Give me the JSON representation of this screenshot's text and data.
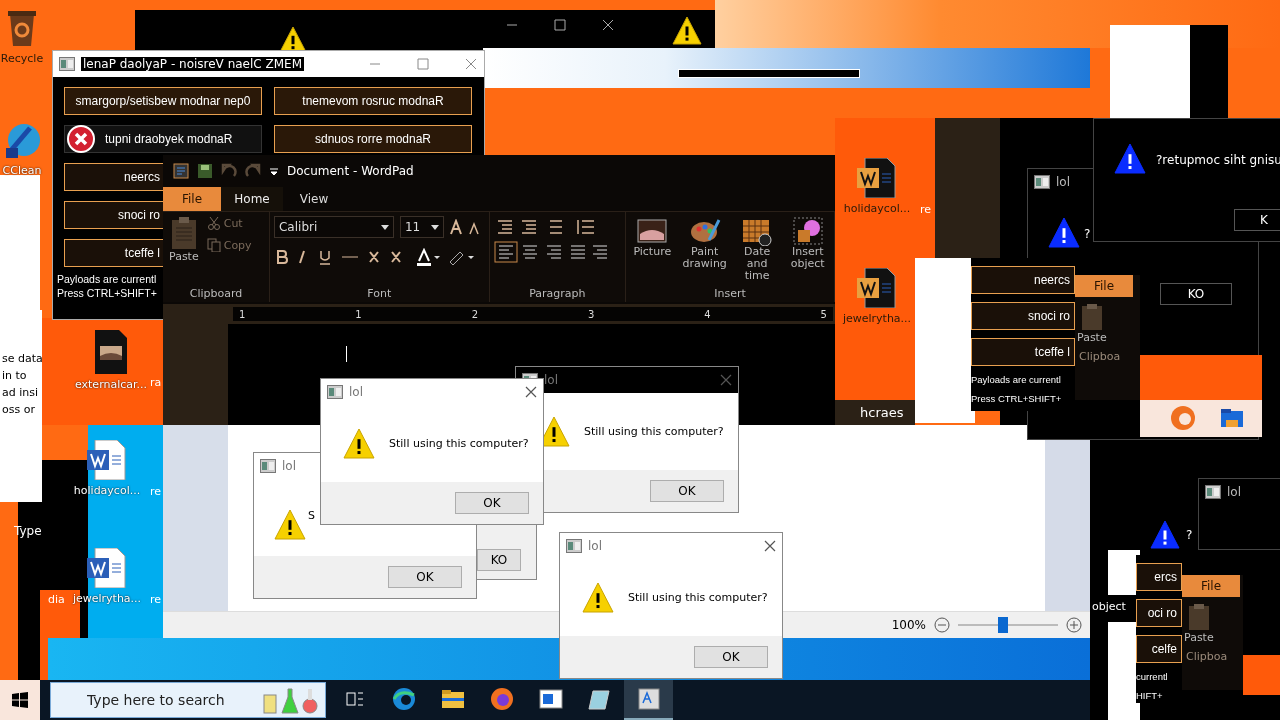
{
  "desktop": {
    "icons": [
      {
        "label": "Recycle",
        "kind": "bin"
      },
      {
        "label": "CClean",
        "kind": "cleaner"
      },
      {
        "label": "externalcar...",
        "kind": "image"
      },
      {
        "label": "ra",
        "kind": "stub"
      },
      {
        "label": "holidaycol...",
        "kind": "word"
      },
      {
        "label": "re",
        "kind": "stub"
      },
      {
        "label": "dia",
        "kind": "stub"
      },
      {
        "label": "jewelrytha...",
        "kind": "word"
      },
      {
        "label": "re",
        "kind": "stub"
      },
      {
        "label": "holidaycol...",
        "kind": "word-dark"
      },
      {
        "label": "re",
        "kind": "stub"
      },
      {
        "label": "jewelrytha...",
        "kind": "word-dark"
      }
    ]
  },
  "left_fragment": {
    "lines": [
      "se data",
      "in to",
      "ad insi",
      "oss or"
    ],
    "type_stub": "Type"
  },
  "memz_panel": {
    "title": "lenaP daolyaP - noisreV naelC ZMEM",
    "buttons": [
      "smargorp/setisbew modnar nep0",
      "tnemevom rosruc modnaR",
      "tupni draobyek modnaR",
      "sdnuos rorre modnaR"
    ],
    "covered_buttons": [
      "neercs",
      "snoci ro",
      "tceffe l"
    ],
    "status": [
      "Payloads are currentl",
      "Press CTRL+SHIFT+"
    ]
  },
  "wordpad": {
    "title": "Document - WordPad",
    "tabs": [
      {
        "label": "File",
        "kind": "file",
        "selected": false
      },
      {
        "label": "Home",
        "kind": "tab",
        "selected": true
      },
      {
        "label": "View",
        "kind": "tab",
        "selected": false
      }
    ],
    "clipboard": {
      "paste": "Paste",
      "cut": "Cut",
      "copy": "Copy",
      "group": "Clipboard"
    },
    "font": {
      "family": "Calibri",
      "size": "11",
      "group": "Font"
    },
    "paragraph": {
      "group": "Paragraph"
    },
    "insert": {
      "items": [
        {
          "label": "Picture",
          "kind": "picture"
        },
        {
          "label": "Paint drawing",
          "kind": "paint"
        },
        {
          "label": "Date and time",
          "kind": "date"
        },
        {
          "label": "Insert object",
          "kind": "object"
        }
      ],
      "group": "Insert"
    },
    "ruler": [
      "1",
      "1",
      "2",
      "3",
      "4",
      "5"
    ]
  },
  "status_bar": {
    "zoom": "100%",
    "level": 0.45
  },
  "dialogs": [
    {
      "title": "lol",
      "message": "Still using this computer?",
      "button": "OK"
    },
    {
      "title": "lol",
      "message": "S",
      "button": "OK"
    },
    {
      "title": "lol",
      "message": "Still using this computer?",
      "button": "OK"
    },
    {
      "title": "lol",
      "message": "Still using this computer?",
      "button": "OK"
    }
  ],
  "ko_fragment": {
    "button": "KO"
  },
  "right_fragments": {
    "search_stub": "hcraes",
    "dark_dialog": {
      "title": "lol",
      "message": "?"
    },
    "inverted_dialog": {
      "message": "?retupmoc siht gnisu",
      "button": "K"
    },
    "ko_button": "KO",
    "panel_copies": [
      {
        "buttons": [
          "neercs",
          "snoci ro",
          "tceffe l"
        ],
        "status": [
          "Payloads are currentl",
          "Press CTRL+SHIFT+"
        ]
      },
      {
        "buttons": [
          "ercs",
          "oci ro",
          "celfe"
        ],
        "status": [
          "currentl",
          "HIFT+"
        ]
      }
    ],
    "wordpad_copies": [
      {
        "tab": "File",
        "paste": "Paste",
        "group": "Clipboa"
      },
      {
        "tab": "File",
        "paste": "Paste",
        "group": "Clipboa"
      }
    ],
    "small_dialog": {
      "title": "lol",
      "message": "?"
    },
    "object_stub": "object"
  },
  "taskbar": {
    "search": {
      "placeholder": "Type here to search"
    },
    "apps": [
      {
        "kind": "taskview",
        "selected": false
      },
      {
        "kind": "edge",
        "selected": false
      },
      {
        "kind": "explorer",
        "selected": false
      },
      {
        "kind": "firefox",
        "selected": false
      },
      {
        "kind": "app",
        "selected": false
      },
      {
        "kind": "notepad",
        "selected": false
      },
      {
        "kind": "wordpad",
        "selected": true
      }
    ]
  }
}
